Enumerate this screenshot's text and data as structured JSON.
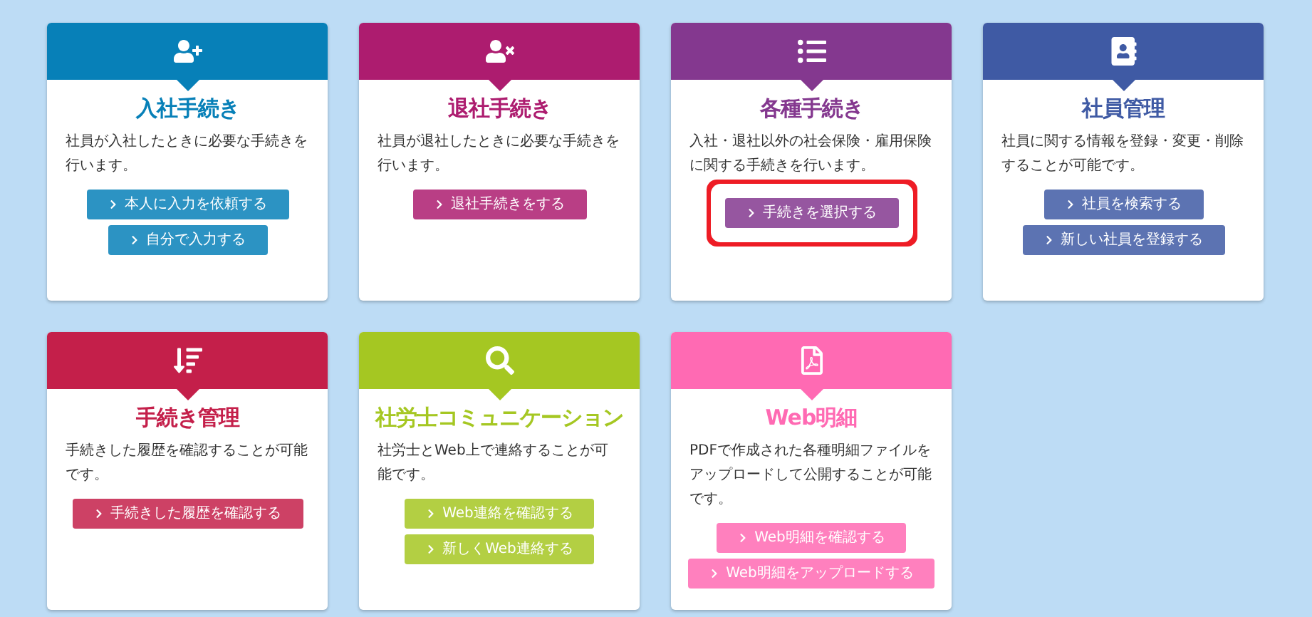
{
  "cards": [
    {
      "kind": "user-add",
      "title": "入社手続き",
      "color": "#0780b8",
      "description": "社員が入社したときに必要な手続きを行います。",
      "buttons": [
        {
          "label": "本人に入力を依頼する",
          "highlighted": false
        },
        {
          "label": "自分で入力する",
          "highlighted": false
        }
      ]
    },
    {
      "kind": "user-remove",
      "title": "退社手続き",
      "color": "#ad1c6f",
      "description": "社員が退社したときに必要な手続きを行います。",
      "buttons": [
        {
          "label": "退社手続きをする",
          "highlighted": false
        }
      ]
    },
    {
      "kind": "list",
      "title": "各種手続き",
      "color": "#84388f",
      "description": "入社・退社以外の社会保険・雇用保険に関する手続きを行います。",
      "buttons": [
        {
          "label": "手続きを選択する",
          "highlighted": true
        }
      ]
    },
    {
      "kind": "contacts",
      "title": "社員管理",
      "color": "#3f5aa4",
      "description": "社員に関する情報を登録・変更・削除することが可能です。",
      "buttons": [
        {
          "label": "社員を検索する",
          "highlighted": false
        },
        {
          "label": "新しい社員を登録する",
          "highlighted": false
        }
      ]
    },
    {
      "kind": "sort",
      "title": "手続き管理",
      "color": "#c41f4a",
      "description": "手続きした履歴を確認することが可能です。",
      "buttons": [
        {
          "label": "手続きした履歴を確認する",
          "highlighted": false
        }
      ]
    },
    {
      "kind": "search",
      "title": "社労士コミュニケーション",
      "color": "#a5c722",
      "description": "社労士とWeb上で連絡することが可能です。",
      "buttons": [
        {
          "label": "Web連絡を確認する",
          "highlighted": false
        },
        {
          "label": "新しくWeb連絡する",
          "highlighted": false
        }
      ]
    },
    {
      "kind": "pdf",
      "title": "Web明細",
      "color": "#ff6ab3",
      "description": "PDFで作成された各種明細ファイルをアップロードして公開することが可能です。",
      "buttons": [
        {
          "label": "Web明細を確認する",
          "highlighted": false
        },
        {
          "label": "Web明細をアップロードする",
          "highlighted": false
        }
      ]
    }
  ]
}
